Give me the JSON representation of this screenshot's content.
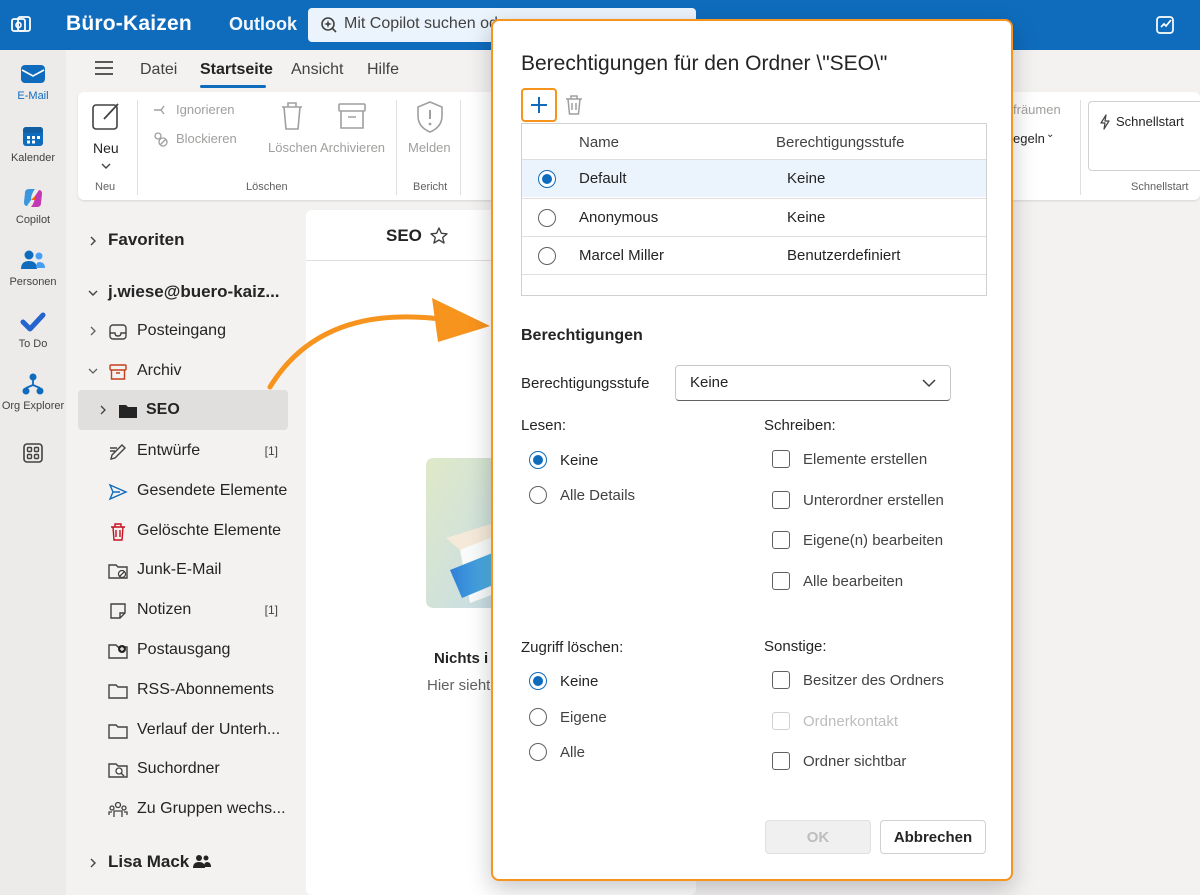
{
  "titlebar": {
    "brand": "Büro-Kaizen",
    "product": "Outlook",
    "search_text": "Mit Copilot suchen oder ...",
    "accent": "#0f6cbd"
  },
  "rail": [
    {
      "label": "E-Mail",
      "icon": "mail-icon",
      "active": true
    },
    {
      "label": "Kalender",
      "icon": "calendar-icon"
    },
    {
      "label": "Copilot",
      "icon": "copilot-icon"
    },
    {
      "label": "Personen",
      "icon": "people-icon"
    },
    {
      "label": "To Do",
      "icon": "todo-icon"
    },
    {
      "label": "Org Explorer",
      "icon": "org-explorer-icon"
    },
    {
      "label": "",
      "icon": "apps-icon"
    }
  ],
  "tabs": [
    "Datei",
    "Startseite",
    "Ansicht",
    "Hilfe"
  ],
  "ribbon": {
    "new": "Neu",
    "new_group": "Neu",
    "ignore": "Ignorieren",
    "block": "Blockieren",
    "delete": "Löschen",
    "archive": "Archivieren",
    "delete_group": "Löschen",
    "report": "Melden",
    "report_group": "Bericht",
    "cleanup": "fräumen",
    "rules": "egeln",
    "quickstart": "Schnellstart",
    "quickstart_group": "Schnellstart"
  },
  "sidebar": {
    "favorites": "Favoriten",
    "account": "j.wiese@buero-kaiz...",
    "folders": [
      {
        "label": "Posteingang",
        "icon": "inbox-icon",
        "count": ""
      },
      {
        "label": "Archiv",
        "icon": "archive-icon",
        "count": ""
      },
      {
        "label": "SEO",
        "icon": "folder-icon",
        "count": "",
        "selected": true
      },
      {
        "label": "Entwürfe",
        "icon": "drafts-icon",
        "count": "[1]"
      },
      {
        "label": "Gesendete Elemente",
        "icon": "sent-icon",
        "count": ""
      },
      {
        "label": "Gelöschte Elemente",
        "icon": "trash-icon",
        "count": ""
      },
      {
        "label": "Junk-E-Mail",
        "icon": "junk-icon",
        "count": ""
      },
      {
        "label": "Notizen",
        "icon": "notes-icon",
        "count": "[1]"
      },
      {
        "label": "Postausgang",
        "icon": "outbox-icon",
        "count": ""
      },
      {
        "label": "RSS-Abonnements",
        "icon": "rss-folder-icon",
        "count": ""
      },
      {
        "label": "Verlauf der Unterh...",
        "icon": "history-folder-icon",
        "count": ""
      },
      {
        "label": "Suchordner",
        "icon": "search-folder-icon",
        "count": ""
      },
      {
        "label": "Zu Gruppen wechs...",
        "icon": "groups-icon",
        "count": ""
      }
    ],
    "second_account": "Lisa Mack"
  },
  "list": {
    "title": "SEO",
    "empty_title": "Nichts i",
    "empty_sub": "Hier sieht"
  },
  "dialog": {
    "title": "Berechtigungen für den Ordner \\\"SEO\\\"",
    "table": {
      "col_name": "Name",
      "col_level": "Berechtigungsstufe",
      "rows": [
        {
          "name": "Default",
          "level": "Keine",
          "selected": true
        },
        {
          "name": "Anonymous",
          "level": "Keine",
          "selected": false
        },
        {
          "name": "Marcel Miller",
          "level": "Benutzerdefiniert",
          "selected": false
        }
      ]
    },
    "section_title": "Berechtigungen",
    "level_label": "Berechtigungsstufe",
    "level_value": "Keine",
    "read_label": "Lesen:",
    "read_options": [
      {
        "label": "Keine",
        "checked": true
      },
      {
        "label": "Alle Details",
        "checked": false
      }
    ],
    "write_label": "Schreiben:",
    "write_options": [
      {
        "label": "Elemente erstellen",
        "checked": false
      },
      {
        "label": "Unterordner erstellen",
        "checked": false
      },
      {
        "label": "Eigene(n) bearbeiten",
        "checked": false
      },
      {
        "label": "Alle bearbeiten",
        "checked": false
      }
    ],
    "delete_label": "Zugriff löschen:",
    "delete_options": [
      {
        "label": "Keine",
        "checked": true
      },
      {
        "label": "Eigene",
        "checked": false
      },
      {
        "label": "Alle",
        "checked": false
      }
    ],
    "other_label": "Sonstige:",
    "other_options": [
      {
        "label": "Besitzer des Ordners",
        "checked": false,
        "disabled": false
      },
      {
        "label": "Ordnerkontakt",
        "checked": false,
        "disabled": true
      },
      {
        "label": "Ordner sichtbar",
        "checked": false,
        "disabled": false
      }
    ],
    "ok": "OK",
    "cancel": "Abbrechen",
    "highlight_color": "#f7941d"
  }
}
